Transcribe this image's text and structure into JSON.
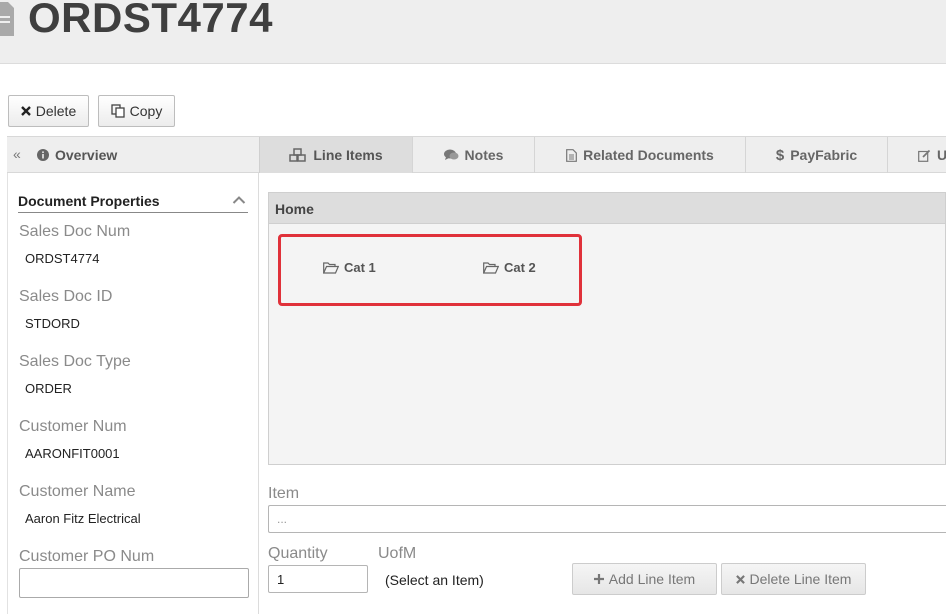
{
  "header": {
    "title": "ORDST4774",
    "doc_icon": "document-icon"
  },
  "toolbar": {
    "delete_label": "Delete",
    "copy_label": "Copy"
  },
  "tabs": {
    "collapse": "«",
    "overview": "Overview",
    "line_items": "Line Items",
    "notes": "Notes",
    "related_documents": "Related Documents",
    "payfabric": "PayFabric",
    "more": "U"
  },
  "properties": {
    "heading": "Document Properties",
    "items": [
      {
        "label": "Sales Doc Num",
        "value": "ORDST4774"
      },
      {
        "label": "Sales Doc ID",
        "value": "STDORD"
      },
      {
        "label": "Sales Doc Type",
        "value": "ORDER"
      },
      {
        "label": "Customer Num",
        "value": "AARONFIT0001"
      },
      {
        "label": "Customer Name",
        "value": "Aaron Fitz Electrical"
      },
      {
        "label": "Customer PO Num",
        "value": ""
      }
    ]
  },
  "catalog": {
    "breadcrumb": "Home",
    "categories": [
      "Cat 1",
      "Cat 2"
    ]
  },
  "line_item_form": {
    "item_label": "Item",
    "item_placeholder": "...",
    "quantity_label": "Quantity",
    "quantity_value": "1",
    "uofm_label": "UofM",
    "uofm_value": "(Select an Item)",
    "add_label": "Add Line Item",
    "delete_label": "Delete Line Item"
  },
  "colors": {
    "highlight": "#e0313a",
    "header_bg": "#eeeeee",
    "active_tab": "#dddddd"
  }
}
